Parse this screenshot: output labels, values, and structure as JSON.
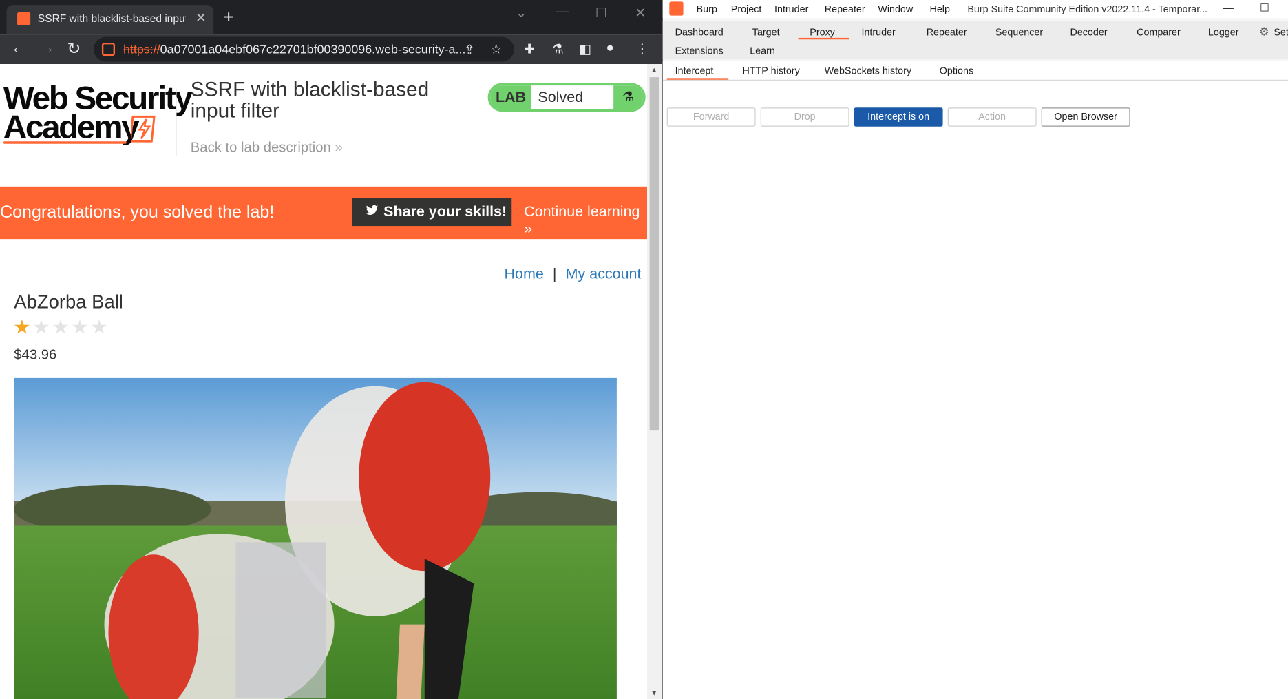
{
  "browser": {
    "tab_title": "SSRF with blacklist-based input fi",
    "url_scheme": "https://",
    "url_rest": "0a07001a04ebf067c22701bf00390096.web-security-a..."
  },
  "site": {
    "logo_line1": "Web Security",
    "logo_line2": "Academy",
    "lab_title": "SSRF with blacklist-based input filter",
    "back_link": "Back to lab description",
    "lab_badge_label": "LAB",
    "lab_status": "Solved",
    "banner_text": "Congratulations, you solved the lab!",
    "share_button": "Share your skills!",
    "continue_link": "Continue learning",
    "nav_home": "Home",
    "nav_separator": "|",
    "nav_account": "My account",
    "product_title": "AbZorba Ball",
    "rating": 1,
    "rating_max": 5,
    "price": "$43.96",
    "accent_color": "#ff6633",
    "solved_color": "#70d16d"
  },
  "burp": {
    "menu": [
      "Burp",
      "Project",
      "Intruder",
      "Repeater",
      "Window",
      "Help"
    ],
    "window_title": "Burp Suite Community Edition v2022.11.4 - Temporar...",
    "tabs_row1": [
      "Dashboard",
      "Target",
      "Proxy",
      "Intruder",
      "Repeater",
      "Sequencer",
      "Decoder",
      "Comparer",
      "Logger"
    ],
    "tabs_row1_extra": "Set",
    "tabs_row2": [
      "Extensions",
      "Learn"
    ],
    "active_tab": "Proxy",
    "subtabs": [
      "Intercept",
      "HTTP history",
      "WebSockets history",
      "Options"
    ],
    "active_subtab": "Intercept",
    "buttons": {
      "forward": "Forward",
      "drop": "Drop",
      "intercept": "Intercept is on",
      "action": "Action",
      "open_browser": "Open Browser"
    }
  }
}
